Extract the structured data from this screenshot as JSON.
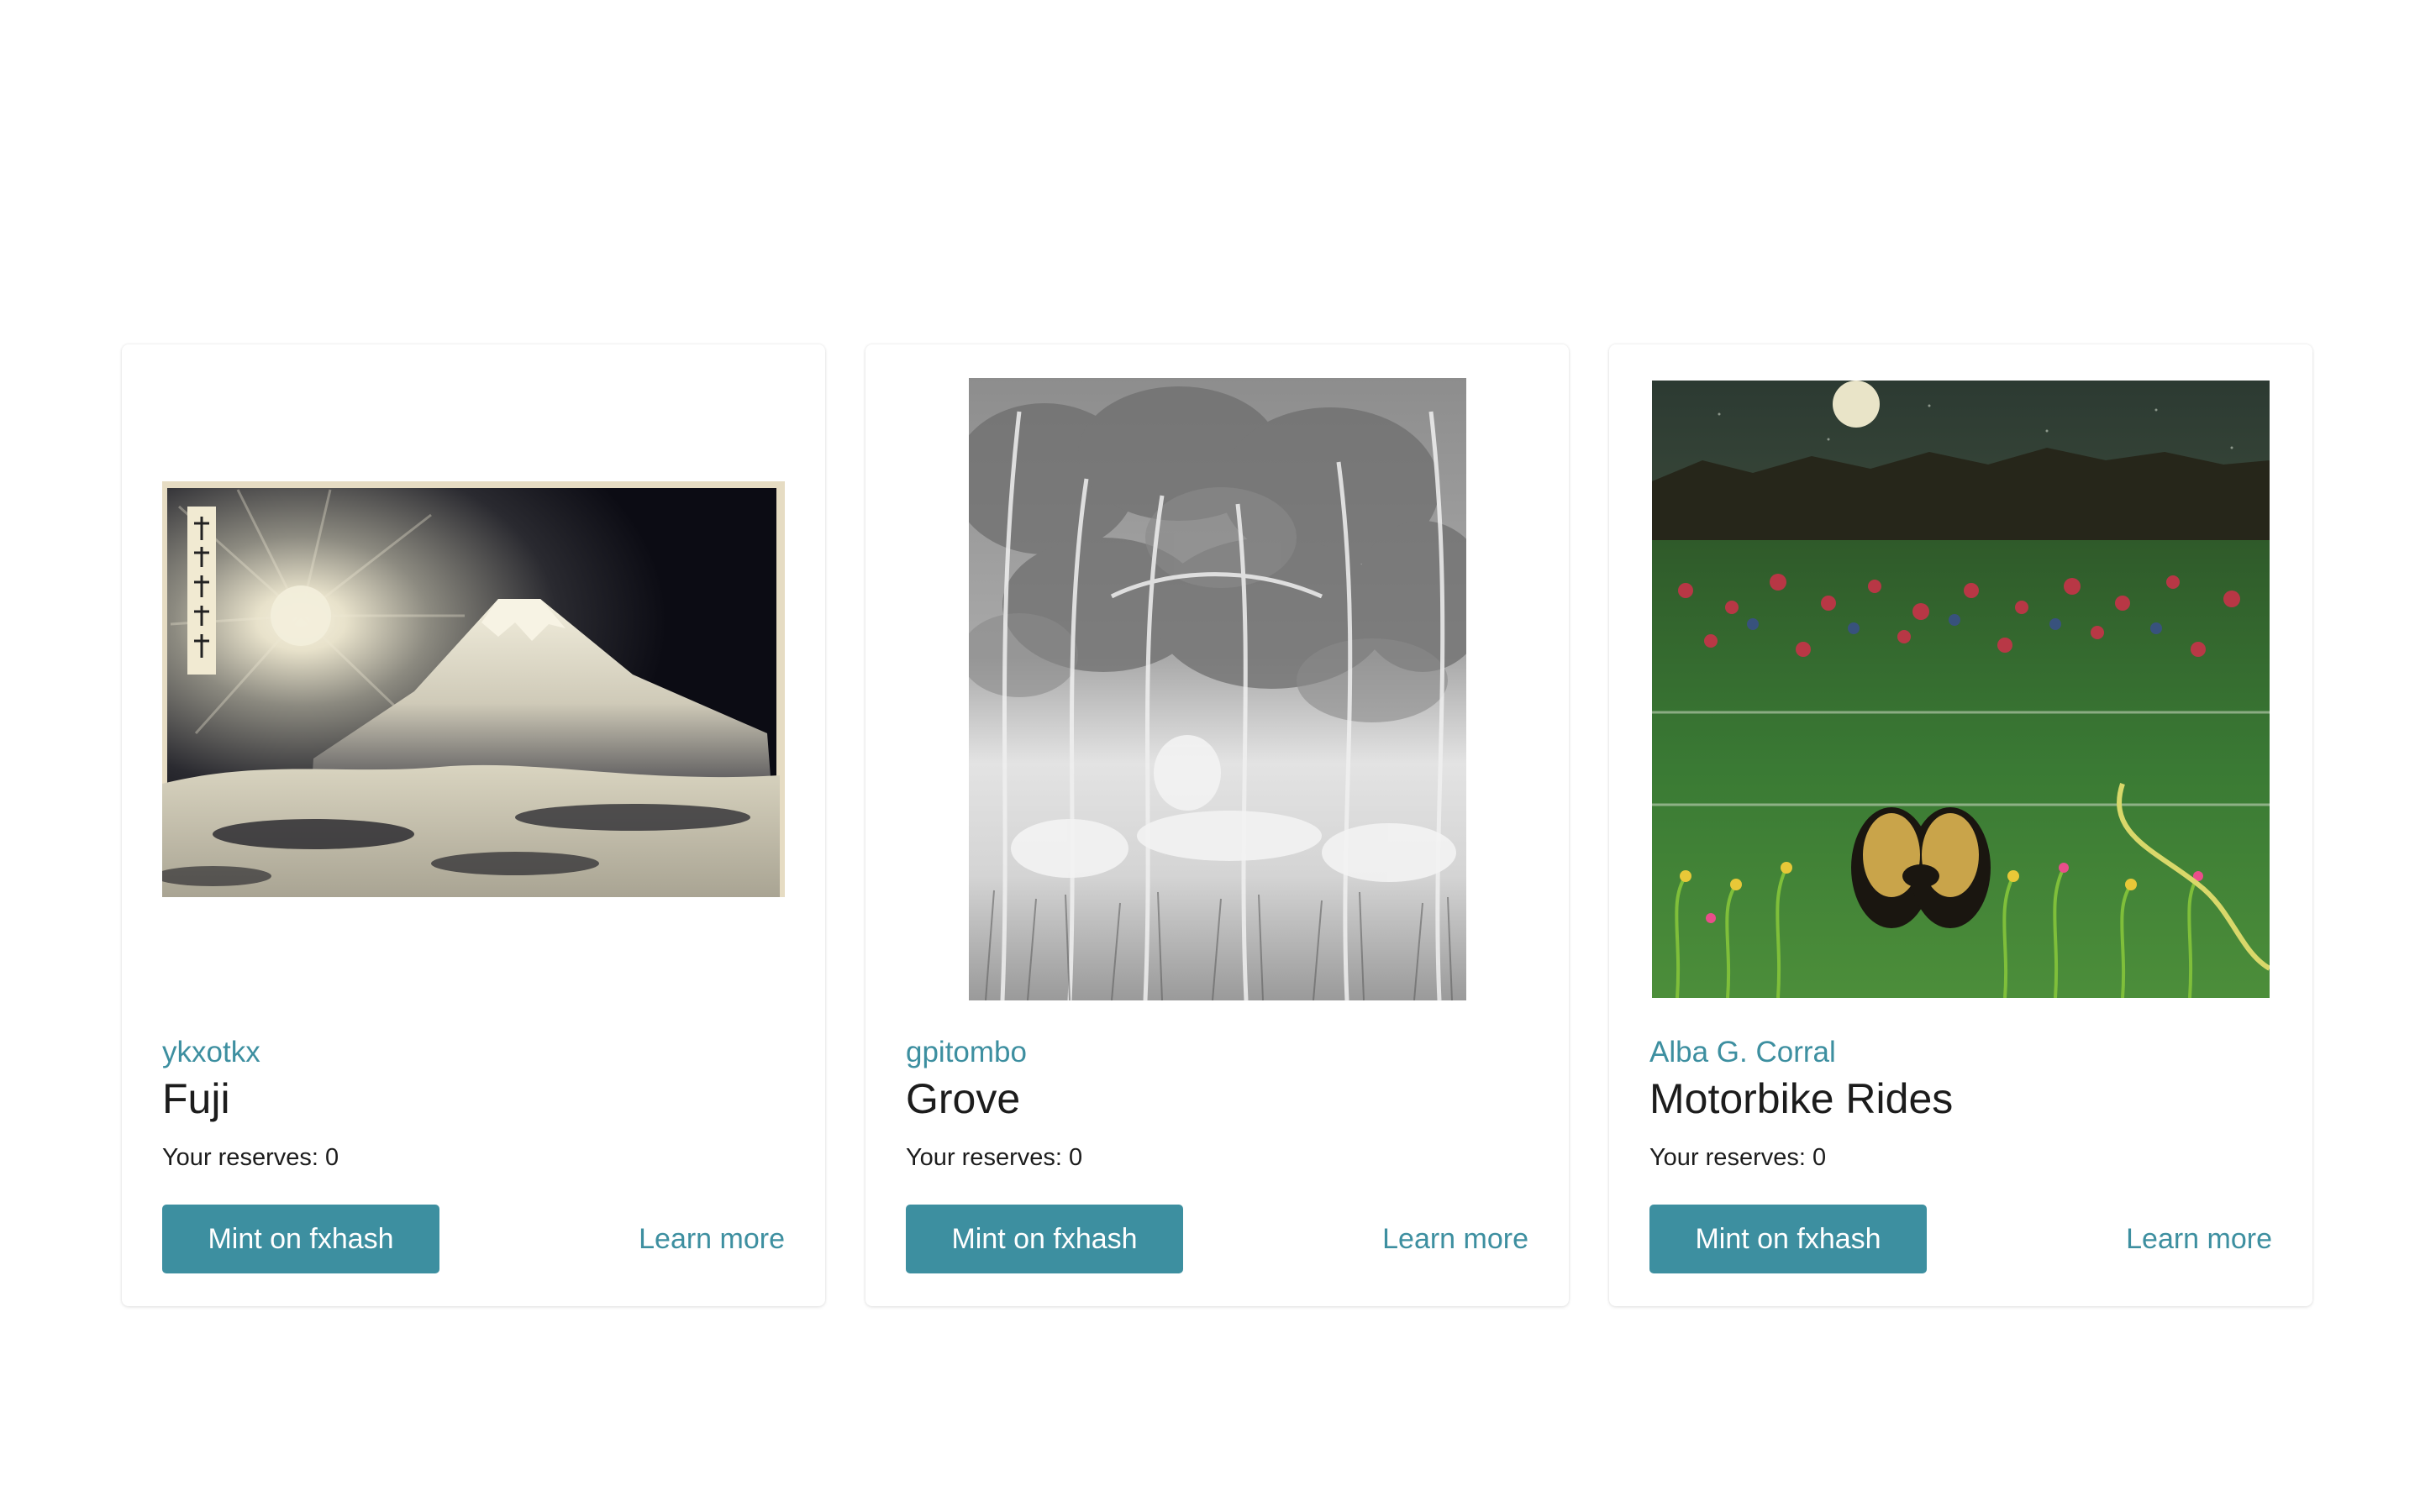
{
  "colors": {
    "accent": "#3d8fa0",
    "text": "#1c1c1c",
    "background": "#ffffff"
  },
  "cards": [
    {
      "artist": "ykxotkx",
      "title": "Fuji",
      "reserves_label": "Your reserves: ",
      "reserves_value": "0",
      "mint_label": "Mint on fxhash",
      "learn_label": "Learn more",
      "art_icon": "fuji-mountain-artwork"
    },
    {
      "artist": "gpitombo",
      "title": "Grove",
      "reserves_label": "Your reserves: ",
      "reserves_value": "0",
      "mint_label": "Mint on fxhash",
      "learn_label": "Learn more",
      "art_icon": "grove-forest-artwork"
    },
    {
      "artist": "Alba G. Corral",
      "title": "Motorbike Rides",
      "reserves_label": "Your reserves: ",
      "reserves_value": "0",
      "mint_label": "Mint on fxhash",
      "learn_label": "Learn more",
      "art_icon": "meadow-moon-artwork"
    }
  ]
}
